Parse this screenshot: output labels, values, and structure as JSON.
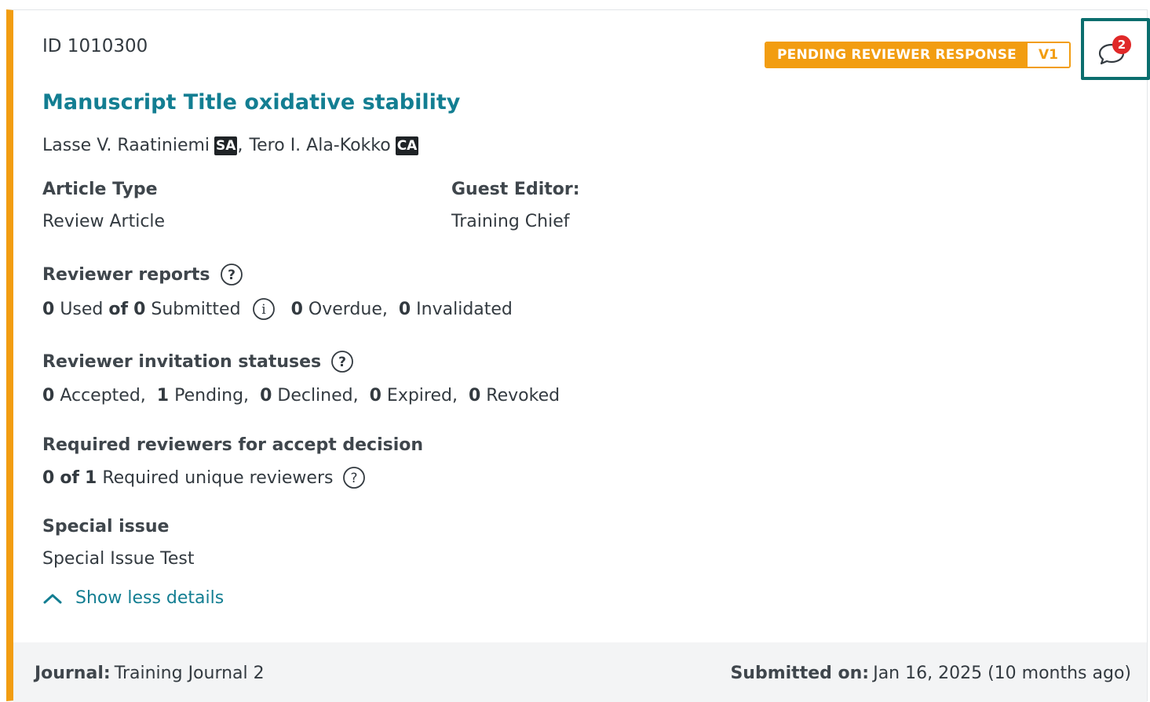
{
  "manuscript": {
    "id": "ID 1010300",
    "title": "Manuscript Title oxidative stability",
    "status": "PENDING REVIEWER RESPONSE",
    "version": "V1",
    "comment_count": "2"
  },
  "authors": [
    {
      "name": "Lasse V. Raatiniemi",
      "role": "SA",
      "separator": ","
    },
    {
      "name": "Tero I. Ala-Kokko",
      "role": "CA"
    }
  ],
  "details": {
    "article_type_label": "Article Type",
    "article_type_value": "Review Article",
    "guest_editor_label": "Guest Editor:",
    "guest_editor_value": "Training Chief",
    "reviewer_reports_label": "Reviewer reports",
    "reports": {
      "used": "0",
      "used_text": "Used",
      "of_text": "of",
      "submitted": "0",
      "submitted_text": "Submitted",
      "overdue": "0",
      "overdue_text": "Overdue,",
      "invalidated": "0",
      "invalidated_text": "Invalidated"
    },
    "invitation_label": "Reviewer invitation statuses",
    "invitations": {
      "accepted": "0",
      "accepted_text": "Accepted,",
      "pending": "1",
      "pending_text": "Pending,",
      "declined": "0",
      "declined_text": "Declined,",
      "expired": "0",
      "expired_text": "Expired,",
      "revoked": "0",
      "revoked_text": "Revoked"
    },
    "required_label": "Required reviewers for accept decision",
    "required": {
      "current": "0",
      "of_text": "of",
      "total": "1",
      "text": "Required unique reviewers"
    },
    "special_issue_label": "Special issue",
    "special_issue_value": "Special Issue Test",
    "show_less": "Show less details"
  },
  "footer": {
    "journal_label": "Journal:",
    "journal_value": "Training Journal 2",
    "submitted_label": "Submitted on:",
    "submitted_value": "Jan 16, 2025 (10 months ago)"
  },
  "colors": {
    "accent_orange": "#f29d11",
    "link_teal": "#137e92",
    "focus_teal": "#0b6e6e",
    "badge_red": "#e02828"
  }
}
